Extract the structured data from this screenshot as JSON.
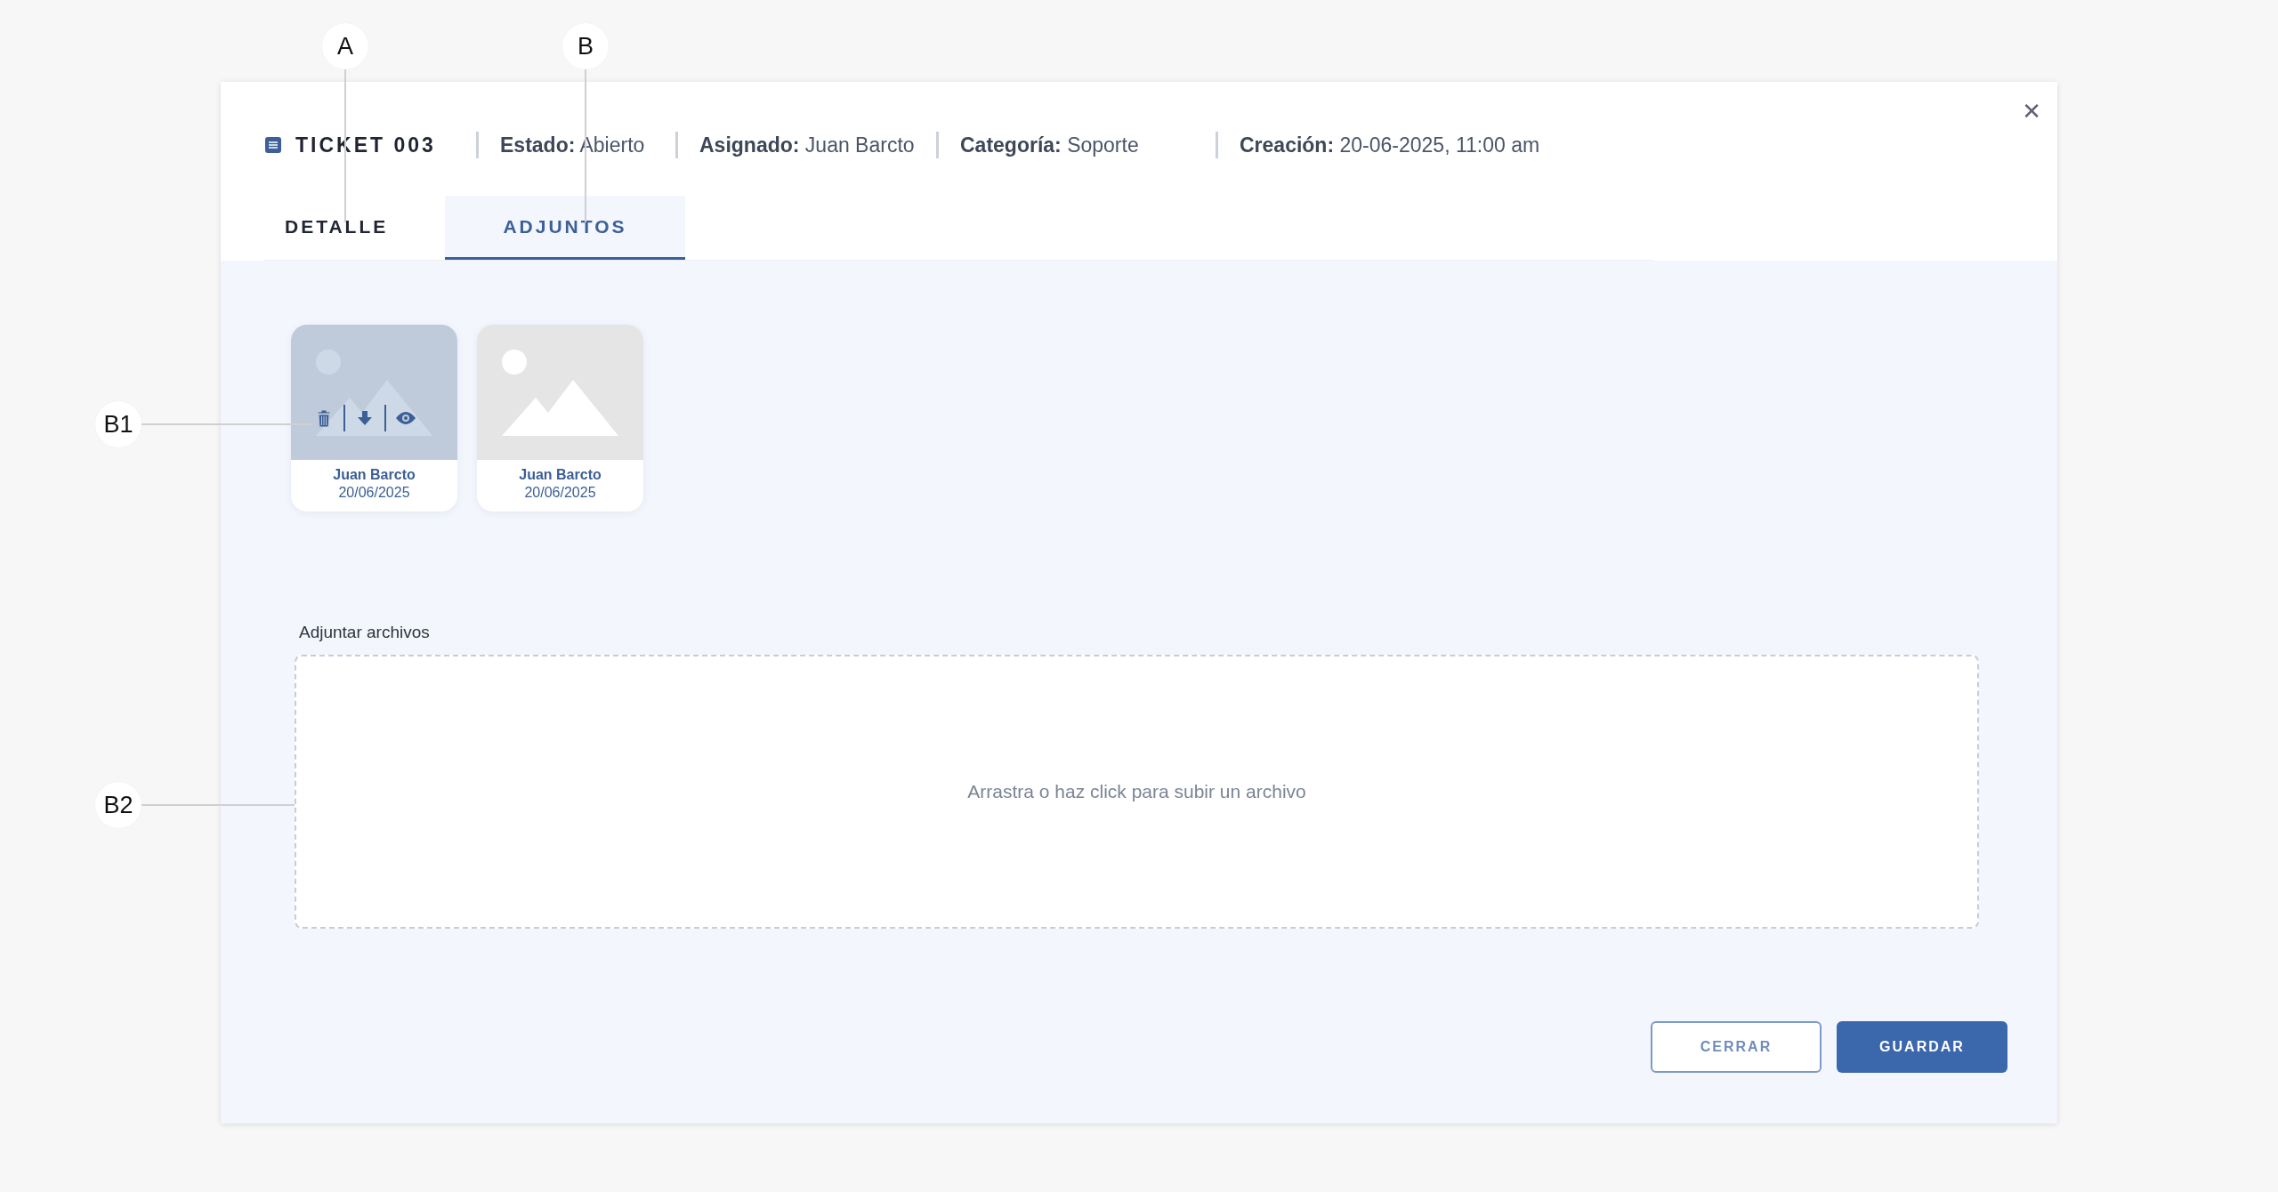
{
  "ticket": {
    "title": "TICKET 003",
    "fields": [
      {
        "text": "**Estado:** Abierto"
      },
      {
        "text": "**Asignado:** Juan Barcto"
      },
      {
        "text": "**Categoría:** Soporte"
      },
      {
        "text": "**Creación:** 20-06-2025, 11:00 am"
      }
    ],
    "close": "✕"
  },
  "tabs": [
    {
      "label": "DETALLE",
      "selected": false
    },
    {
      "label": "ADJUNTOS",
      "selected": true
    }
  ],
  "attachments": [
    {
      "author": "Juan Barcto",
      "date": "20/06/2025",
      "hovered": true
    },
    {
      "author": "Juan Barcto",
      "date": "20/06/2025",
      "hovered": false
    }
  ],
  "upload": {
    "label": "Adjuntar archivos",
    "placeholder": "Arrastra o haz click para subir un archivo"
  },
  "buttons": [
    {
      "label": "CERRAR",
      "kind": "secondary"
    },
    {
      "label": "GUARDAR",
      "kind": "primary"
    }
  ],
  "annotations": [
    {
      "label": "A"
    },
    {
      "label": "B"
    },
    {
      "label": "B1"
    },
    {
      "label": "B2"
    }
  ]
}
